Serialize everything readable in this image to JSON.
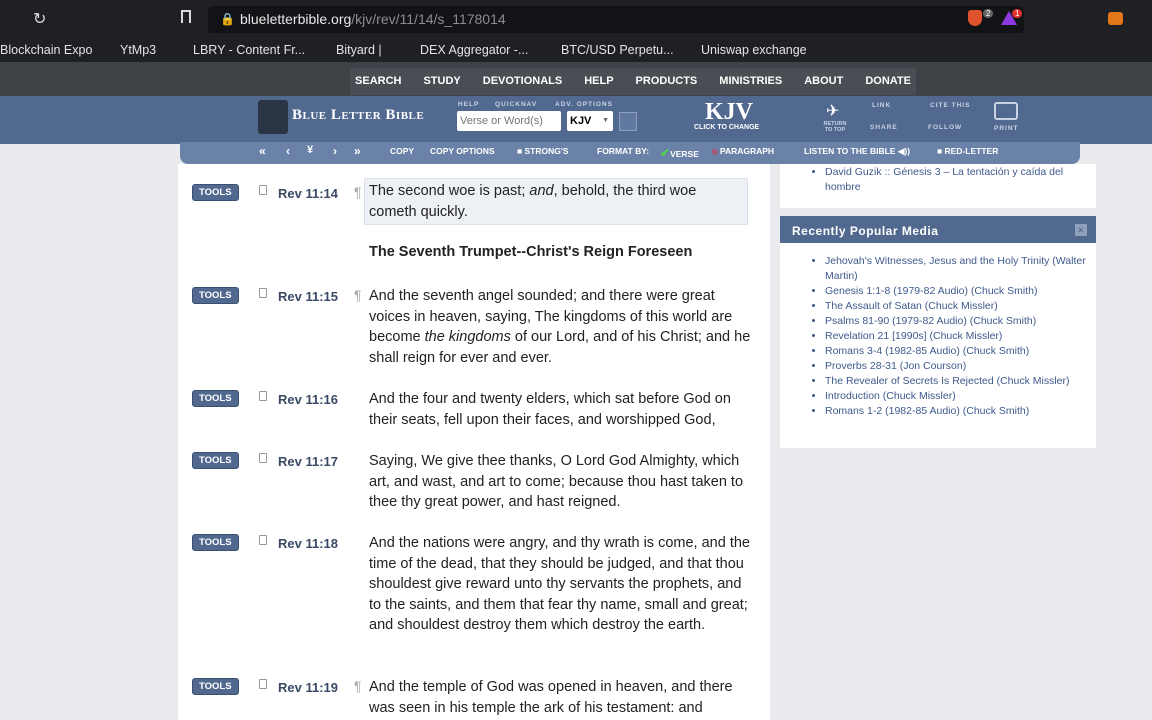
{
  "browser": {
    "url_host": "blueletterbible.org",
    "url_path": "/kjv/rev/11/14/s_1178014",
    "bookmarks": [
      "Blockchain Expo",
      "YtMp3",
      "LBRY - Content Fr...",
      "Bityard |",
      "DEX Aggregator -...",
      "BTC/USD Perpetu...",
      "Uniswap exchange"
    ],
    "shield_badge": "2",
    "alert_badge": "1"
  },
  "nav": [
    "SEARCH",
    "STUDY",
    "DEVOTIONALS",
    "HELP",
    "PRODUCTS",
    "MINISTRIES",
    "ABOUT",
    "DONATE"
  ],
  "header": {
    "logo": "Blue Letter Bible",
    "help": "HELP",
    "quicknav": "QUICKNAV",
    "adv": "ADV. OPTIONS",
    "search_placeholder": "Verse or Word(s)",
    "version_select": "KJV",
    "version": "KJV",
    "click_change": "CLICK TO CHANGE",
    "return_top": "RETURN TO TOP",
    "link": "LINK",
    "cite": "CITE THIS",
    "share": "SHARE",
    "follow": "FOLLOW",
    "print": "PRINT"
  },
  "toolbar": {
    "copy": "COPY",
    "copy_options": "COPY OPTIONS",
    "strongs": "STRONG'S",
    "format_by": "FORMAT BY:",
    "verse": "VERSE",
    "paragraph": "PARAGRAPH",
    "listen": "LISTEN TO THE BIBLE",
    "red_letter": "RED-LETTER"
  },
  "tools_label": "TOOLS",
  "heading": "The Seventh Trumpet--Christ's Reign Foreseen",
  "verses": [
    {
      "ref": "Rev 11:14",
      "pilcrow": true,
      "html": "The second woe is past; <i>and</i>, behold, the third woe cometh quickly."
    },
    {
      "ref": "Rev 11:15",
      "pilcrow": true,
      "html": "And the seventh angel sounded; and there were great voices in heaven, saying, The kingdoms of this world are become <i>the kingdoms</i> of our Lord, and of his Christ; and he shall reign for ever and ever."
    },
    {
      "ref": "Rev 11:16",
      "pilcrow": false,
      "html": "And the four and twenty elders, which sat before God on their seats, fell upon their faces, and worshipped God,"
    },
    {
      "ref": "Rev 11:17",
      "pilcrow": false,
      "html": "Saying, We give thee thanks, O Lord God Almighty, which art, and wast, and art to come; because thou hast taken to thee thy great power, and hast reigned."
    },
    {
      "ref": "Rev 11:18",
      "pilcrow": false,
      "html": "And the nations were angry, and thy wrath is come, and the time of the dead, that they should be judged, and that thou shouldest give reward unto thy servants the prophets, and to the saints, and them that fear thy name, small and great; and shouldest destroy them which destroy the earth."
    },
    {
      "ref": "Rev 11:19",
      "pilcrow": true,
      "html": "And the temple of God was opened in heaven, and there was seen in his temple the ark of his testament: and"
    }
  ],
  "sidebar": {
    "prev_item": "David Guzik :: Génesis 3 – La tentación y caída del hombre",
    "media_title": "Recently Popular Media",
    "media": [
      "Jehovah's Witnesses, Jesus and the Holy Trinity (Walter Martin)",
      "Genesis 1:1-8 (1979-82 Audio) (Chuck Smith)",
      "The Assault of Satan (Chuck Missler)",
      "Psalms 81-90 (1979-82 Audio) (Chuck Smith)",
      "Revelation 21 [1990s] (Chuck Missler)",
      "Romans 3-4 (1982-85 Audio) (Chuck Smith)",
      "Proverbs 28-31 (Jon Courson)",
      "The Revealer of Secrets Is Rejected (Chuck Missler)",
      "Introduction (Chuck Missler)",
      "Romans 1-2 (1982-85 Audio) (Chuck Smith)"
    ]
  },
  "colors": {
    "brand": "#52698f",
    "toolbar": "#6b82a8"
  }
}
